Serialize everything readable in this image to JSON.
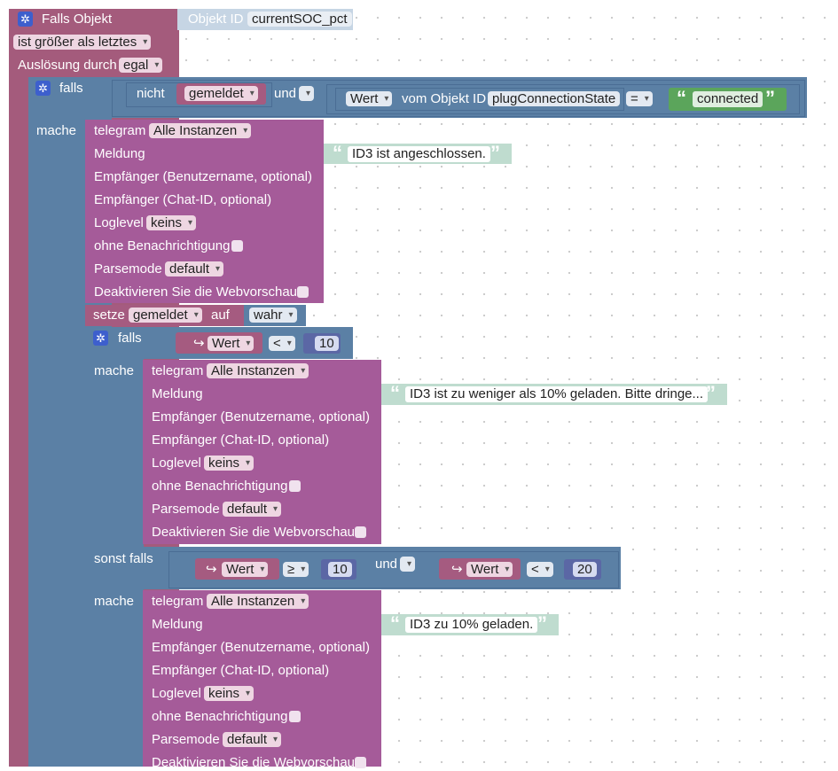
{
  "event": {
    "falls_objekt": "Falls Objekt",
    "objekt_id_label": "Objekt ID",
    "objekt_id_value": "currentSOC_pct",
    "condition": "ist größer als letztes",
    "ausloesung_label": "Auslösung durch",
    "ausloesung_value": "egal"
  },
  "if1": {
    "falls": "falls",
    "nicht": "nicht",
    "var": "gemeldet",
    "und": "und",
    "wert": "Wert",
    "vom_objekt": "vom Objekt ID",
    "objekt": "plugConnectionState",
    "op": "=",
    "text": "connected",
    "mache": "mache"
  },
  "telegram_labels": {
    "telegram": "telegram",
    "instanzen": "Alle Instanzen",
    "meldung": "Meldung",
    "empf_user": "Empfänger (Benutzername, optional)",
    "empf_chat": "Empfänger (Chat-ID, optional)",
    "loglevel": "Loglevel",
    "loglevel_value": "keins",
    "ohne": "ohne Benachrichtigung",
    "parsemode": "Parsemode",
    "parsemode_value": "default",
    "deaktivieren": "Deaktivieren Sie die Webvorschau"
  },
  "msg1": "ID3 ist angeschlossen.",
  "setze": {
    "setze": "setze",
    "var": "gemeldet",
    "auf": "auf",
    "value": "wahr"
  },
  "if2": {
    "falls": "falls",
    "var": "Wert",
    "op": "<",
    "num": "10",
    "mache": "mache",
    "sonst_falls": "sonst falls",
    "var2": "Wert",
    "op2": "≥",
    "num2": "10",
    "und": "und",
    "var3": "Wert",
    "op3": "<",
    "num3": "20",
    "mache2": "mache"
  },
  "msg2": "ID3 ist zu weniger als 10% geladen. Bitte dringe...",
  "msg3": "ID3 zu 10% geladen.",
  "colors": {
    "event": "#a45b7c",
    "logic": "#5b80a5",
    "telegram": "#a55b99",
    "text": "#bfdccf"
  }
}
